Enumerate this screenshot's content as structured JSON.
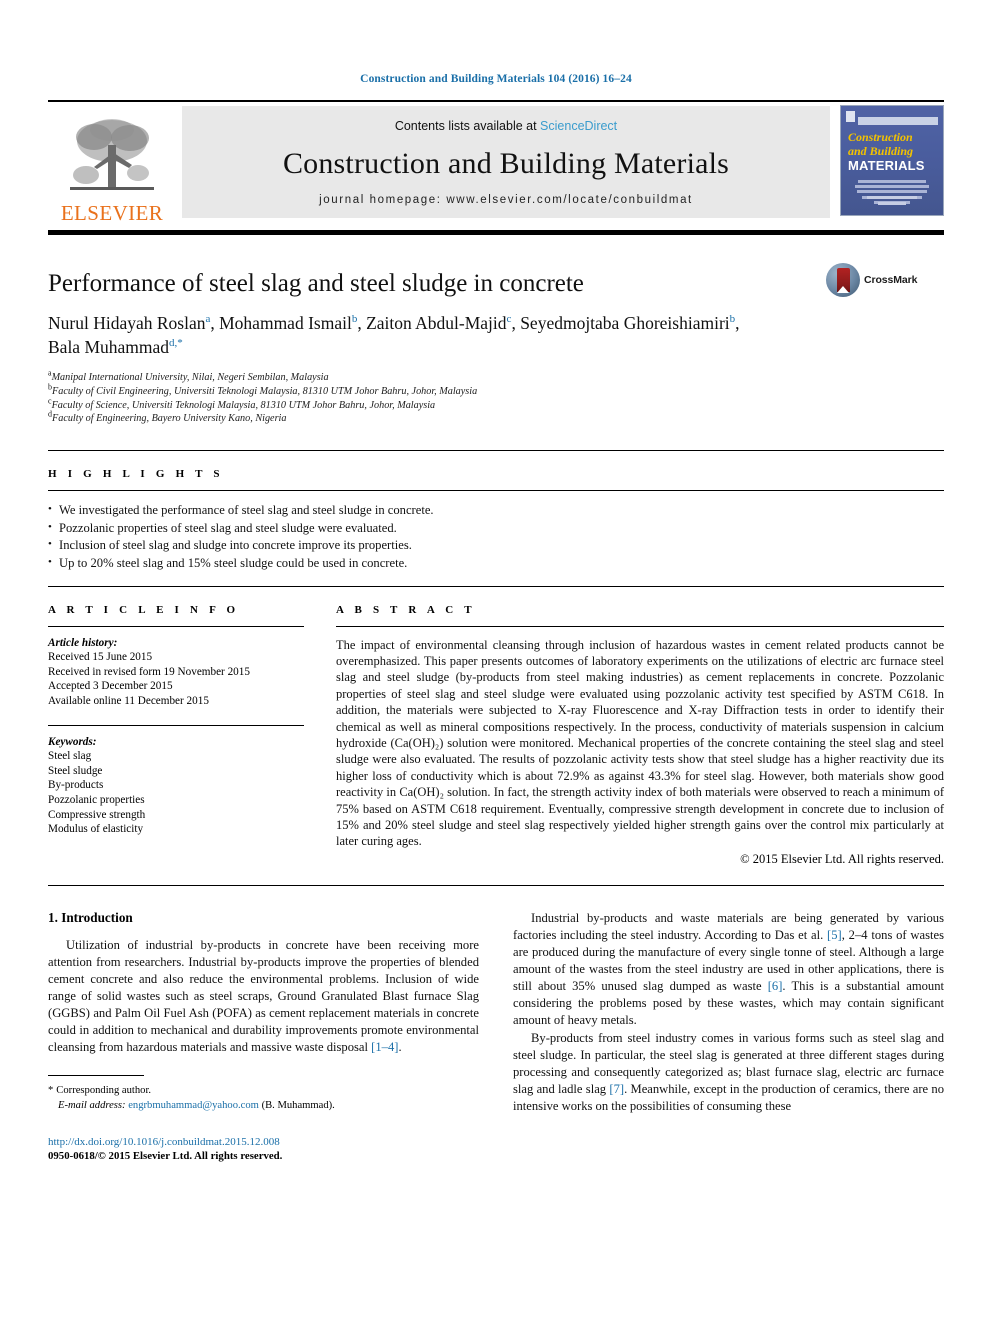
{
  "running_head": "Construction and Building Materials 104 (2016) 16–24",
  "masthead": {
    "publisher_logo_label": "ELSEVIER",
    "contents_prefix": "Contents lists available at ",
    "contents_link": "ScienceDirect",
    "journal_title": "Construction and Building Materials",
    "homepage": "journal homepage: www.elsevier.com/locate/conbuildmat",
    "cover": {
      "line1": "Construction",
      "line2": "and Building",
      "line3": "MATERIALS"
    }
  },
  "article": {
    "title": "Performance of steel slag and steel sludge in concrete",
    "crossmark_label": "CrossMark",
    "authors_line1": "Nurul Hidayah Roslan a, Mohammad Ismail b, Zaiton Abdul-Majid c, Seyedmojtaba Ghoreishiamiri b,",
    "authors_line2": "Bala Muhammad d,*",
    "authors": [
      {
        "name": "Nurul Hidayah Roslan",
        "mark": "a"
      },
      {
        "name": "Mohammad Ismail",
        "mark": "b"
      },
      {
        "name": "Zaiton Abdul-Majid",
        "mark": "c"
      },
      {
        "name": "Seyedmojtaba Ghoreishiamiri",
        "mark": "b"
      },
      {
        "name": "Bala Muhammad",
        "mark": "d,*"
      }
    ],
    "affiliations": [
      {
        "mark": "a",
        "text": "Manipal International University, Nilai, Negeri Sembilan, Malaysia"
      },
      {
        "mark": "b",
        "text": "Faculty of Civil Engineering, Universiti Teknologi Malaysia, 81310 UTM Johor Bahru, Johor, Malaysia"
      },
      {
        "mark": "c",
        "text": "Faculty of Science, Universiti Teknologi Malaysia, 81310 UTM Johor Bahru, Johor, Malaysia"
      },
      {
        "mark": "d",
        "text": "Faculty of Engineering, Bayero University Kano, Nigeria"
      }
    ]
  },
  "highlights": {
    "heading": "H I G H L I G H T S",
    "items": [
      "We investigated the performance of steel slag and steel sludge in concrete.",
      "Pozzolanic properties of steel slag and steel sludge were evaluated.",
      "Inclusion of steel slag and sludge into concrete improve its properties.",
      "Up to 20% steel slag and 15% steel sludge could be used in concrete."
    ]
  },
  "article_info": {
    "heading": "A R T I C L E    I N F O",
    "history_label": "Article history:",
    "history": [
      "Received 15 June 2015",
      "Received in revised form 19 November 2015",
      "Accepted 3 December 2015",
      "Available online 11 December 2015"
    ],
    "keywords_label": "Keywords:",
    "keywords": [
      "Steel slag",
      "Steel sludge",
      "By-products",
      "Pozzolanic properties",
      "Compressive strength",
      "Modulus of elasticity"
    ]
  },
  "abstract": {
    "heading": "A B S T R A C T",
    "text": "The impact of environmental cleansing through inclusion of hazardous wastes in cement related products cannot be overemphasized. This paper presents outcomes of laboratory experiments on the utilizations of electric arc furnace steel slag and steel sludge (by-products from steel making industries) as cement replacements in concrete. Pozzolanic properties of steel slag and steel sludge were evaluated using pozzolanic activity test specified by ASTM C618. In addition, the materials were subjected to X-ray Fluorescence and X-ray Diffraction tests in order to identify their chemical as well as mineral compositions respectively. In the process, conductivity of materials suspension in calcium hydroxide (Ca(OH)₂) solution were monitored. Mechanical properties of the concrete containing the steel slag and steel sludge were also evaluated. The results of pozzolanic activity tests show that steel sludge has a higher reactivity due its higher loss of conductivity which is about 72.9% as against 43.3% for steel slag. However, both materials show good reactivity in Ca(OH)₂ solution. In fact, the strength activity index of both materials were observed to reach a minimum of 75% based on ASTM C618 requirement. Eventually, compressive strength development in concrete due to inclusion of 15% and 20% steel sludge and steel slag respectively yielded higher strength gains over the control mix particularly at later curing ages.",
    "copyright": "© 2015 Elsevier Ltd. All rights reserved."
  },
  "body": {
    "section_heading": "1. Introduction",
    "left_paragraphs": [
      "Utilization of industrial by-products in concrete have been receiving more attention from researchers. Industrial by-products improve the properties of blended cement concrete and also reduce the environmental problems. Inclusion of wide range of solid wastes such as steel scraps, Ground Granulated Blast furnace Slag (GGBS) and Palm Oil Fuel Ash (POFA) as cement replacement materials in concrete could in addition to mechanical and durability improvements promote environmental cleansing from hazardous materials and massive waste disposal [1–4]."
    ],
    "right_paragraphs": [
      "Industrial by-products and waste materials are being generated by various factories including the steel industry. According to Das et al. [5], 2–4 tons of wastes are produced during the manufacture of every single tonne of steel. Although a large amount of the wastes from the steel industry are used in other applications, there is still about 35% unused slag dumped as waste [6]. This is a substantial amount considering the problems posed by these wastes, which may contain significant amount of heavy metals.",
      "By-products from steel industry comes in various forms such as steel slag and steel sludge. In particular, the steel slag is generated at three different stages during processing and consequently categorized as; blast furnace slag, electric arc furnace slag and ladle slag [7]. Meanwhile, except in the production of ceramics, there are no intensive works on the possibilities of consuming these"
    ]
  },
  "footnotes": {
    "corresponding_marker": "*",
    "corresponding_text": "Corresponding author.",
    "email_label": "E-mail address:",
    "email": "engrbmuhammad@yahoo.com",
    "email_owner": "(B. Muhammad).",
    "doi": "http://dx.doi.org/10.1016/j.conbuildmat.2015.12.008",
    "issn_line": "0950-0618/© 2015 Elsevier Ltd. All rights reserved."
  },
  "colors": {
    "link_blue": "#1a6fa8",
    "sciencedirect_blue": "#3a9ccd",
    "elsevier_orange": "#E9711C",
    "cover_blue": "#4a5d9e",
    "cover_yellow": "#f2c200"
  }
}
